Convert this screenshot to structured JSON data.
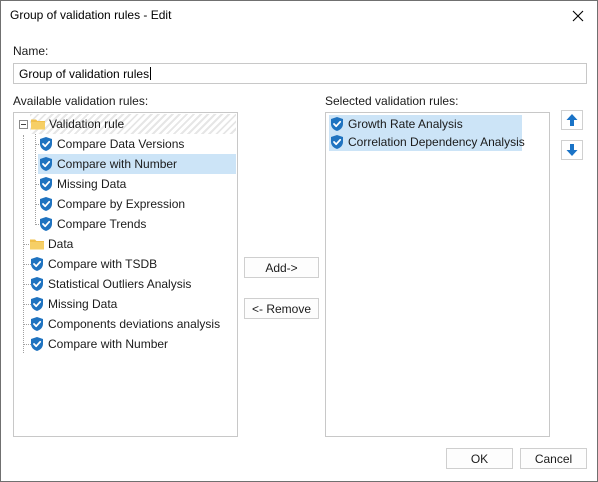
{
  "dialog": {
    "title": "Group of validation rules - Edit"
  },
  "name_field": {
    "label": "Name:",
    "value": "Group of validation rules"
  },
  "available": {
    "label": "Available validation rules:",
    "tree": {
      "group1": {
        "label": "Validation rule",
        "icon": "folder-icon"
      },
      "group1_items": [
        {
          "label": "Compare Data Versions",
          "icon": "shield-check-icon"
        },
        {
          "label": "Compare with Number",
          "icon": "shield-check-icon",
          "selected": true
        },
        {
          "label": "Missing Data",
          "icon": "shield-check-icon"
        },
        {
          "label": "Compare by Expression",
          "icon": "shield-check-icon"
        },
        {
          "label": "Compare Trends",
          "icon": "shield-check-icon"
        }
      ],
      "group2": {
        "label": "Data",
        "icon": "folder-icon"
      },
      "root_items": [
        {
          "label": "Compare with TSDB",
          "icon": "shield-check-icon"
        },
        {
          "label": "Statistical Outliers Analysis",
          "icon": "shield-check-icon"
        },
        {
          "label": "Missing Data",
          "icon": "shield-check-icon"
        },
        {
          "label": "Components deviations analysis",
          "icon": "shield-check-icon"
        },
        {
          "label": "Compare with Number",
          "icon": "shield-check-icon"
        }
      ]
    }
  },
  "selected": {
    "label": "Selected validation rules:",
    "items": [
      {
        "label": "Growth Rate Analysis",
        "icon": "shield-check-icon"
      },
      {
        "label": "Correlation Dependency Analysis",
        "icon": "shield-check-icon"
      }
    ]
  },
  "buttons": {
    "add": "Add->",
    "remove": "<- Remove",
    "ok": "OK",
    "cancel": "Cancel",
    "move_up_icon": "arrow-up-icon",
    "move_down_icon": "arrow-down-icon"
  },
  "colors": {
    "selection": "#cce4f7",
    "shield": "#1f73c0",
    "folder": "#f1c04b",
    "arrow": "#1a73c7"
  }
}
